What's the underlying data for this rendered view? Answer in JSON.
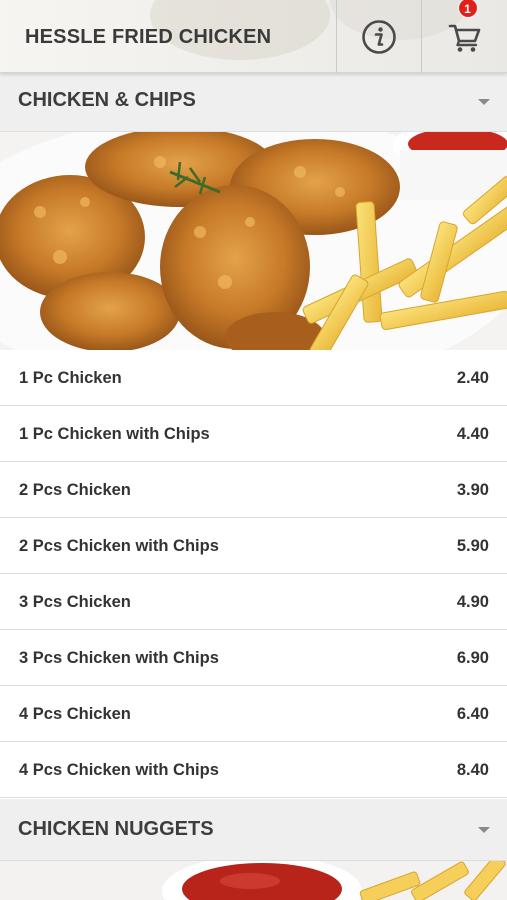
{
  "header": {
    "title": "HESSLE FRIED CHICKEN",
    "cart_count": "1"
  },
  "categories": [
    {
      "title": "CHICKEN & CHIPS",
      "items": [
        {
          "name": "1 Pc Chicken",
          "price": "2.40"
        },
        {
          "name": "1 Pc Chicken with Chips",
          "price": "4.40"
        },
        {
          "name": "2 Pcs Chicken",
          "price": "3.90"
        },
        {
          "name": "2 Pcs Chicken with Chips",
          "price": "5.90"
        },
        {
          "name": "3 Pcs Chicken",
          "price": "4.90"
        },
        {
          "name": "3 Pcs Chicken with Chips",
          "price": "6.90"
        },
        {
          "name": "4 Pcs Chicken",
          "price": "6.40"
        },
        {
          "name": "4 Pcs Chicken with Chips",
          "price": "8.40"
        }
      ]
    },
    {
      "title": "CHICKEN NUGGETS",
      "items": []
    }
  ],
  "colors": {
    "badge": "#e0201b",
    "category_bg": "#efefef",
    "text": "#333333"
  },
  "icons": [
    "info-icon",
    "cart-icon",
    "chevron-down-icon"
  ]
}
